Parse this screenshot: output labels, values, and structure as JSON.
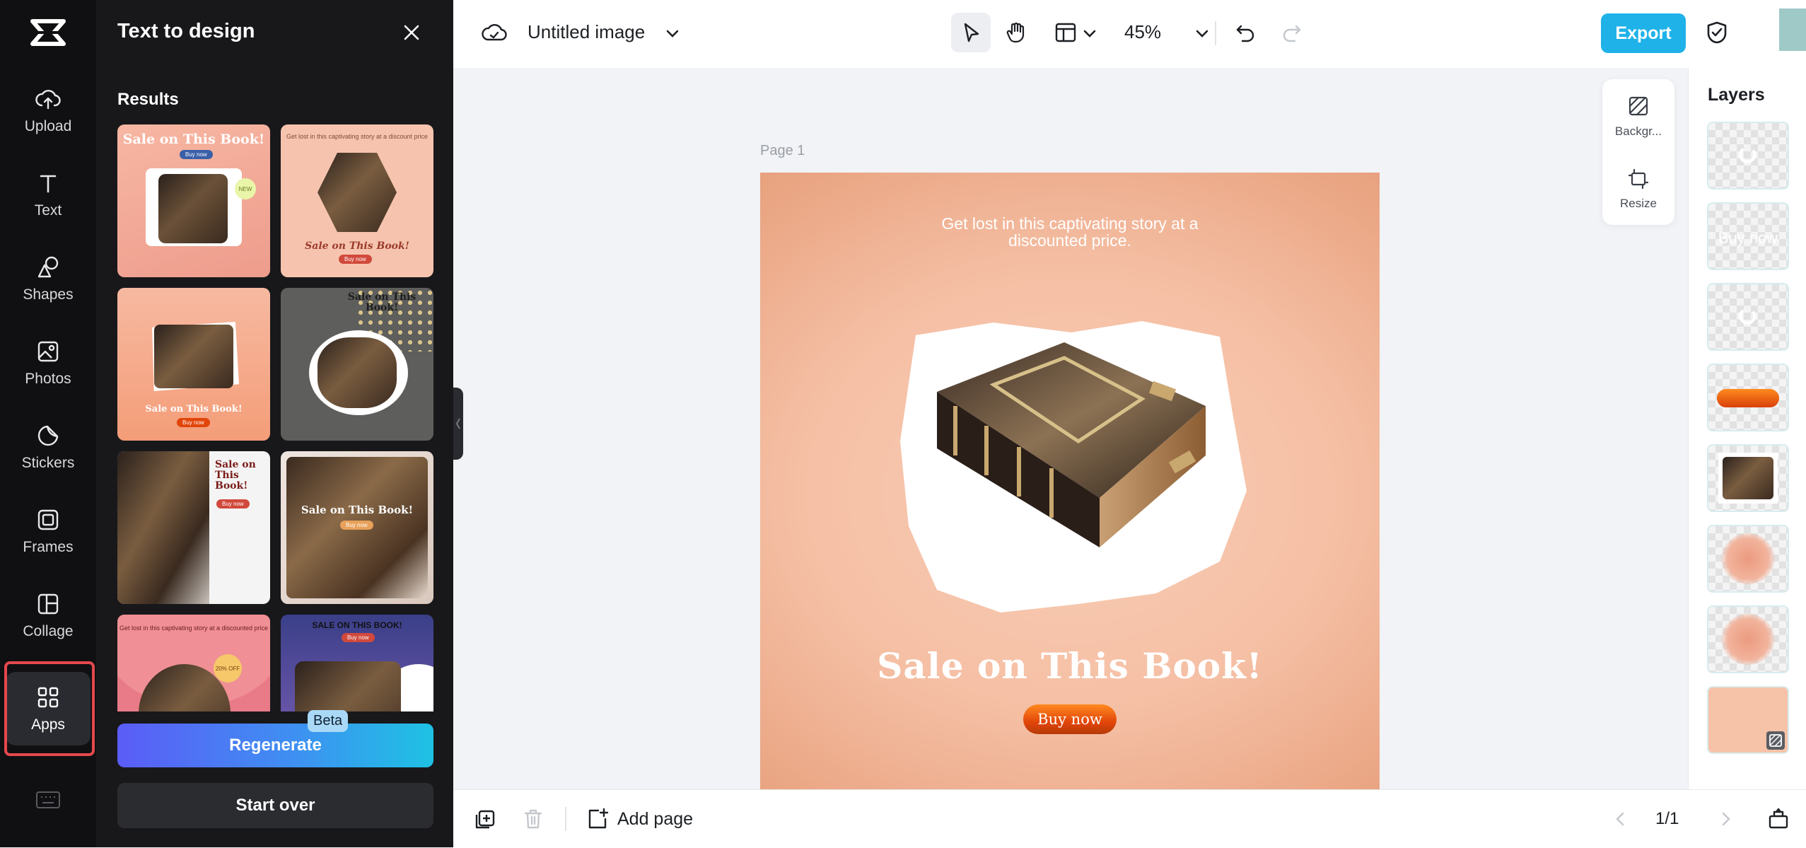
{
  "rail": {
    "items": [
      {
        "label": "Upload",
        "icon": "upload-cloud-icon"
      },
      {
        "label": "Text",
        "icon": "text-icon"
      },
      {
        "label": "Shapes",
        "icon": "shapes-icon"
      },
      {
        "label": "Photos",
        "icon": "photos-icon"
      },
      {
        "label": "Stickers",
        "icon": "stickers-icon"
      },
      {
        "label": "Frames",
        "icon": "frames-icon"
      },
      {
        "label": "Collage",
        "icon": "collage-icon"
      },
      {
        "label": "Apps",
        "icon": "apps-grid-icon"
      }
    ],
    "active": "Apps",
    "highlight_color": "#e5484d"
  },
  "panel": {
    "title": "Text to design",
    "results_label": "Results",
    "regenerate_label": "Regenerate",
    "beta_label": "Beta",
    "start_over_label": "Start over",
    "thumbnails": [
      {
        "heading": "Sale on This Book!",
        "button": "Buy now",
        "badge": "NEW"
      },
      {
        "heading": "Sale on This Book!",
        "button": "Buy now",
        "subtitle": "Get lost in this captivating story at a discount price"
      },
      {
        "heading": "Sale on This Book!",
        "button": "Buy now"
      },
      {
        "heading": "Sale on This Book!",
        "button": "Buy now"
      },
      {
        "heading": "Sale on This Book!",
        "button": "Buy now"
      },
      {
        "heading": "Sale on This Book!",
        "button": "Buy now"
      },
      {
        "heading": "",
        "badge": "20% OFF",
        "subtitle": "Get lost in this captivating story at a discounted price"
      },
      {
        "heading": "SALE ON THIS BOOK!",
        "button": "Buy now"
      }
    ]
  },
  "topbar": {
    "doc_title": "Untitled image",
    "zoom": "45%",
    "export_label": "Export",
    "accent": "#1fb2e8"
  },
  "canvas": {
    "page_label": "Page 1",
    "subtitle": "Get lost in this captivating story at a discounted price.",
    "heading": "Sale on This Book!",
    "button_label": "Buy now",
    "background": "#f5bfa4"
  },
  "float_tools": {
    "background_label": "Backgr...",
    "resize_label": "Resize"
  },
  "layers": {
    "title": "Layers",
    "items": [
      {
        "type": "loading"
      },
      {
        "type": "text",
        "text": "Buy now"
      },
      {
        "type": "loading"
      },
      {
        "type": "button-shape"
      },
      {
        "type": "book-image"
      },
      {
        "type": "blur-circle"
      },
      {
        "type": "blur-circle"
      },
      {
        "type": "background"
      }
    ]
  },
  "bottombar": {
    "add_page_label": "Add page",
    "page_count": "1/1"
  }
}
